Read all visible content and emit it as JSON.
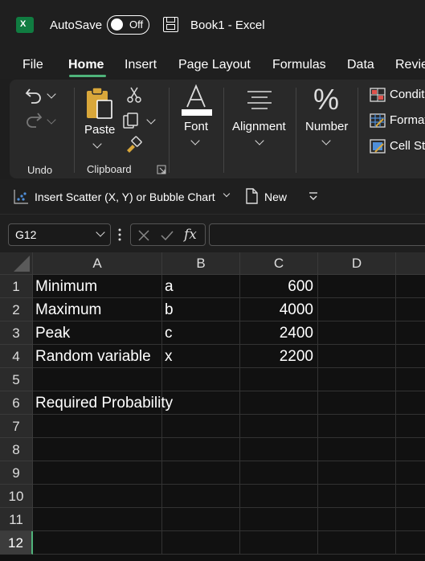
{
  "titlebar": {
    "app_icon": "excel-logo-icon",
    "app_letter": "X",
    "autosave_label": "AutoSave",
    "autosave_state": "Off",
    "save_icon": "save-icon",
    "document_title": "Book1  -  Excel"
  },
  "tabs": [
    "File",
    "Home",
    "Insert",
    "Page Layout",
    "Formulas",
    "Data",
    "Revie"
  ],
  "active_tab": "Home",
  "ribbon": {
    "undo_group": "Undo",
    "clipboard_group": "Clipboard",
    "paste_label": "Paste",
    "font_label": "Font",
    "alignment_label": "Alignment",
    "number_label": "Number",
    "number_symbol": "%",
    "styles": [
      "Conditi",
      "Format",
      "Cell St"
    ]
  },
  "qat": {
    "scatter_label": "Insert Scatter (X, Y) or Bubble Chart",
    "new_label": "New"
  },
  "formula_bar": {
    "name_box": "G12",
    "fx_symbol": "fx",
    "formula_value": ""
  },
  "sheet": {
    "columns": [
      "A",
      "B",
      "C",
      "D"
    ],
    "rows": [
      {
        "n": "1",
        "a": "Minimum",
        "b": "a",
        "c": "600"
      },
      {
        "n": "2",
        "a": "Maximum",
        "b": "b",
        "c": "4000"
      },
      {
        "n": "3",
        "a": "Peak",
        "b": "c",
        "c": "2400"
      },
      {
        "n": "4",
        "a": "Random variable",
        "b": "x",
        "c": "2200"
      },
      {
        "n": "5",
        "a": "",
        "b": "",
        "c": ""
      },
      {
        "n": "6",
        "a": "Required Probability",
        "b": "",
        "c": ""
      },
      {
        "n": "7",
        "a": "",
        "b": "",
        "c": ""
      },
      {
        "n": "8",
        "a": "",
        "b": "",
        "c": ""
      },
      {
        "n": "9",
        "a": "",
        "b": "",
        "c": ""
      },
      {
        "n": "10",
        "a": "",
        "b": "",
        "c": ""
      },
      {
        "n": "11",
        "a": "",
        "b": "",
        "c": ""
      },
      {
        "n": "12",
        "a": "",
        "b": "",
        "c": ""
      }
    ],
    "selected_row": "12"
  },
  "colors": {
    "accent": "#4fb37a",
    "excel_green": "#107c41",
    "background": "#1f1f1f"
  }
}
